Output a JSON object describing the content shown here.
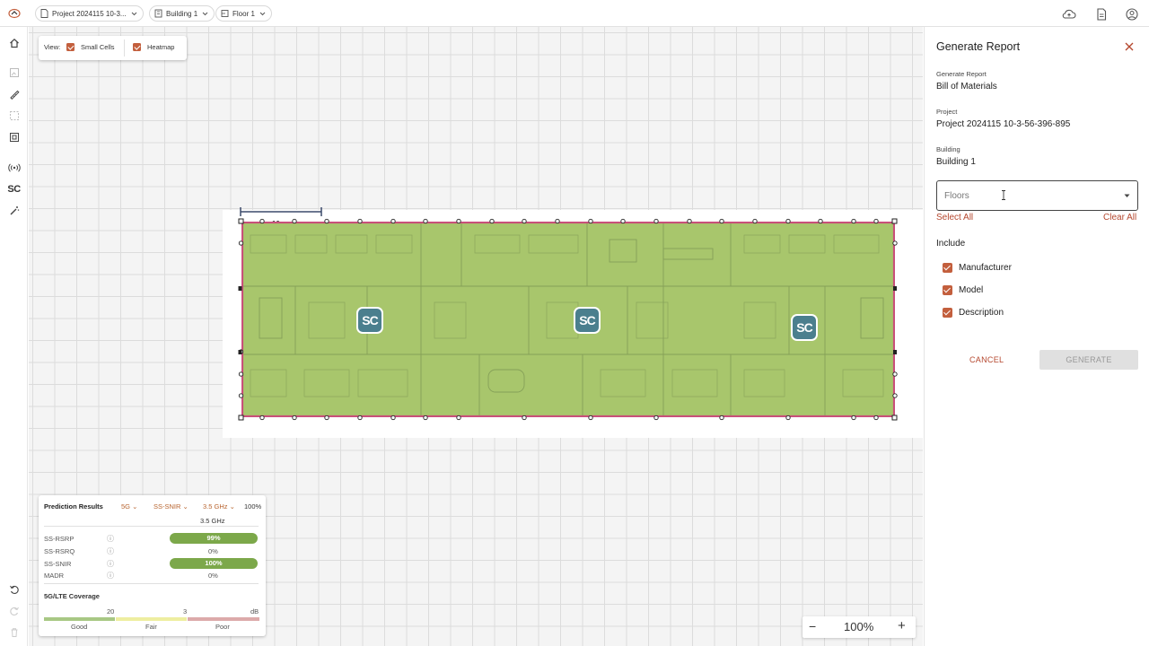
{
  "topbar": {
    "project_crumb": "Project 2024115 10-3...",
    "building_crumb": "Building 1",
    "floor_crumb": "Floor 1"
  },
  "view_panel": {
    "label": "View:",
    "small_cells_label": "Small Cells",
    "heatmap_label": "Heatmap"
  },
  "floorplan": {
    "scale_label": "10 m",
    "small_cells": [
      "SC",
      "SC",
      "SC"
    ],
    "coverage_color": "#a8c66c",
    "boundary_color": "#c8507a"
  },
  "left_toolbar": {
    "sc_label": "SC"
  },
  "prediction": {
    "title": "Prediction Results",
    "tech": "5G",
    "metric": "SS-SNIR",
    "band": "3.5 GHz",
    "overall_pct": "100%",
    "column_header": "3.5 GHz",
    "rows": [
      {
        "name": "SS-RSRP",
        "value": "99%",
        "fill": 0.99
      },
      {
        "name": "SS-RSRQ",
        "value": "0%",
        "fill": 0
      },
      {
        "name": "SS-SNIR",
        "value": "100%",
        "fill": 1.0
      },
      {
        "name": "MADR",
        "value": "0%",
        "fill": 0
      }
    ],
    "coverage_title": "5G/LTE Coverage",
    "thresholds": [
      "20",
      "3",
      "dB"
    ],
    "legend": [
      "Good",
      "Fair",
      "Poor"
    ],
    "legend_colors": [
      "#a8c884",
      "#eeeea0",
      "#dcaaaa"
    ]
  },
  "zoom": {
    "minus": "−",
    "value": "100%",
    "plus": "+"
  },
  "report": {
    "title": "Generate Report",
    "generate_report_label": "Generate Report",
    "generate_report_value": "Bill of Materials",
    "project_label": "Project",
    "project_value": "Project 2024115 10-3-56-396-895",
    "building_label": "Building",
    "building_value": "Building 1",
    "floors_placeholder": "Floors",
    "select_all": "Select All",
    "clear_all": "Clear All",
    "include_label": "Include",
    "options": [
      "Manufacturer",
      "Model",
      "Description"
    ],
    "cancel": "CANCEL",
    "generate": "GENERATE",
    "accent_color": "#c35f3d"
  }
}
